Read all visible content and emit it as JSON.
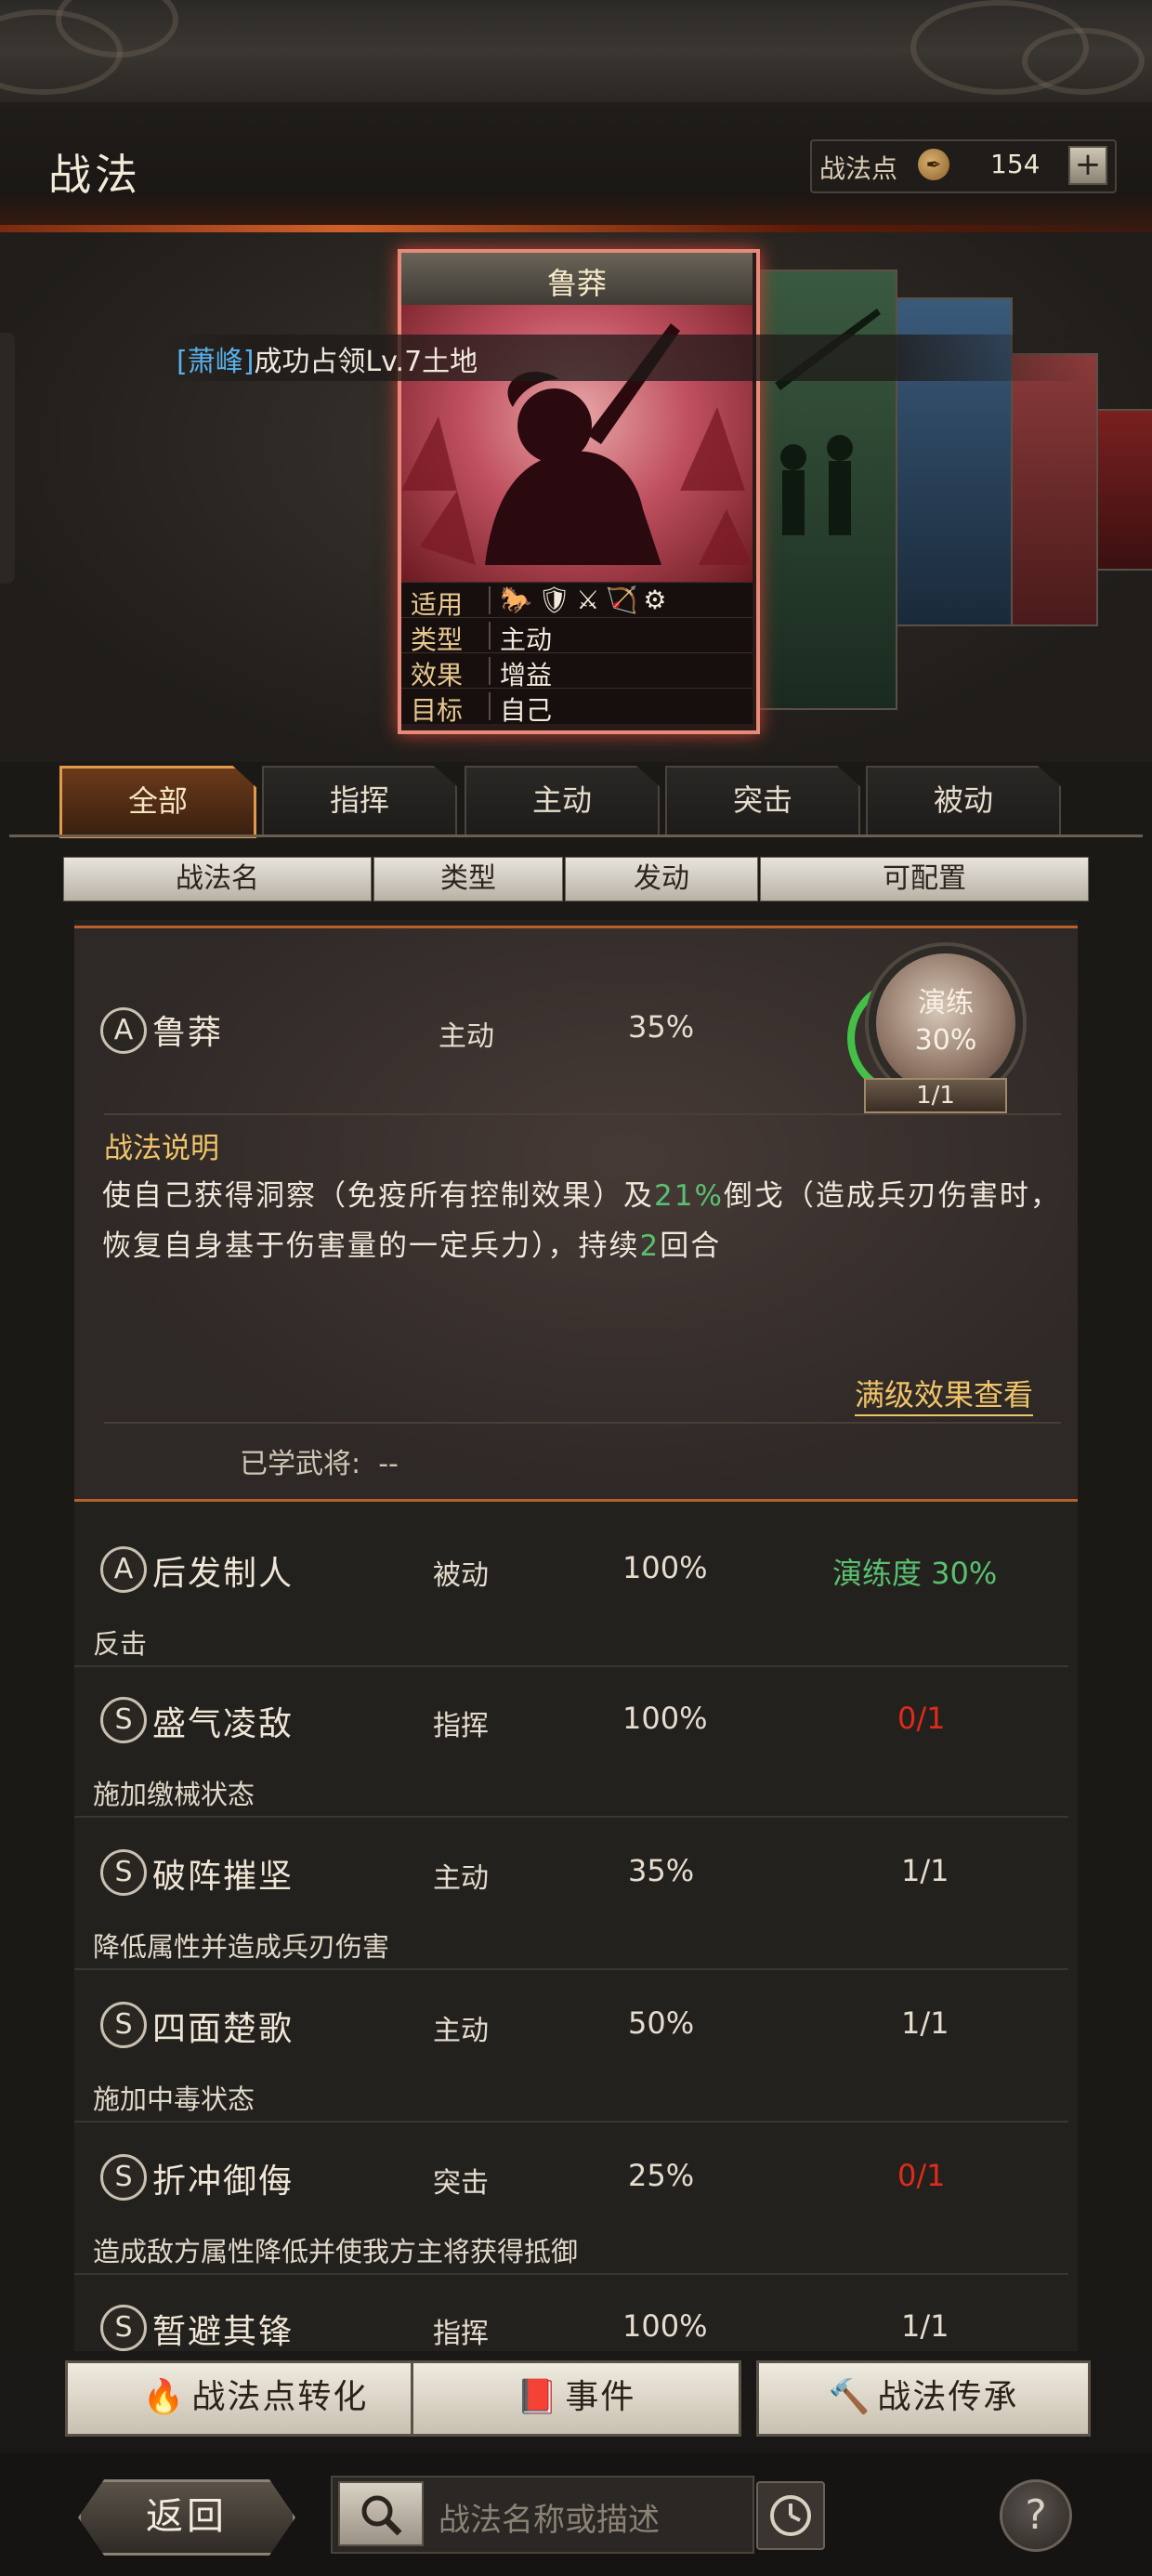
{
  "header": {
    "title": "战法",
    "points_label": "战法点",
    "points_value": "154",
    "add_label": "+"
  },
  "notice": {
    "tag": "[萧峰]",
    "text": "成功占领Lv.7土地"
  },
  "card": {
    "name": "鲁莽",
    "rows": [
      {
        "key": "适用",
        "value": "🐎🛡⚔🏹⚙"
      },
      {
        "key": "类型",
        "value": "主动"
      },
      {
        "key": "效果",
        "value": "增益"
      },
      {
        "key": "目标",
        "value": "自己"
      }
    ]
  },
  "tabs": [
    "全部",
    "指挥",
    "主动",
    "突击",
    "被动"
  ],
  "columns": [
    "战法名",
    "类型",
    "发动",
    "可配置"
  ],
  "selected": {
    "grade": "A",
    "name": "鲁莽",
    "type": "主动",
    "rate": "35%",
    "drill_label": "演练",
    "drill_pct": "30%",
    "drill_count": "1/1",
    "drill_progress": 0.3,
    "desc_title": "战法说明",
    "desc_part1": "使自己获得洞察（免疫所有控制效果）及",
    "desc_green1": "21%",
    "desc_part2": "倒戈（造成兵刃伤害时，恢复自身基于伤害量的一定兵力），持续",
    "desc_green2": "2",
    "desc_part3": "回合",
    "full_effect_link": "满级效果查看",
    "learned_label": "已学武将:",
    "learned_value": "--"
  },
  "rows": [
    {
      "grade": "A",
      "name": "后发制人",
      "type": "被动",
      "rate": "100%",
      "conf": "演练度 30%",
      "conf_color": "#5ac070",
      "desc": "反击"
    },
    {
      "grade": "S",
      "name": "盛气凌敌",
      "type": "指挥",
      "rate": "100%",
      "conf": "0/1",
      "conf_color": "#e02a1a",
      "desc": "施加缴械状态"
    },
    {
      "grade": "S",
      "name": "破阵摧坚",
      "type": "主动",
      "rate": "35%",
      "conf": "1/1",
      "conf_color": "#e6ddce",
      "desc": "降低属性并造成兵刃伤害"
    },
    {
      "grade": "S",
      "name": "四面楚歌",
      "type": "主动",
      "rate": "50%",
      "conf": "1/1",
      "conf_color": "#e6ddce",
      "desc": "施加中毒状态"
    },
    {
      "grade": "S",
      "name": "折冲御侮",
      "type": "突击",
      "rate": "25%",
      "conf": "0/1",
      "conf_color": "#e02a1a",
      "desc": "造成敌方属性降低并使我方主将获得抵御"
    },
    {
      "grade": "S",
      "name": "暂避其锋",
      "type": "指挥",
      "rate": "100%",
      "conf": "1/1",
      "conf_color": "#e6ddce",
      "desc": ""
    }
  ],
  "buttons": {
    "convert": "战法点转化",
    "event": "事件",
    "inherit": "战法传承"
  },
  "footer": {
    "back": "返回",
    "search_placeholder": "战法名称或描述",
    "help": "?"
  }
}
